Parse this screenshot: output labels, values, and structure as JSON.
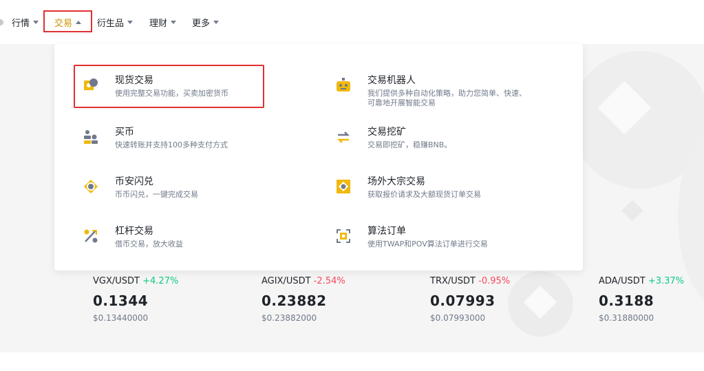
{
  "nav": {
    "items": [
      {
        "label": "行情"
      },
      {
        "label": "交易"
      },
      {
        "label": "衍生品"
      },
      {
        "label": "理财"
      },
      {
        "label": "更多"
      }
    ]
  },
  "dropdown": {
    "left_items": [
      {
        "title": "现货交易",
        "desc": "使用完整交易功能，买卖加密货币",
        "icon": "spot-trade-icon"
      },
      {
        "title": "买币",
        "desc": "快速转账并支持100多种支付方式",
        "icon": "buy-crypto-icon"
      },
      {
        "title": "币安闪兑",
        "desc": "币币闪兑，一键完成交易",
        "icon": "convert-icon"
      },
      {
        "title": "杠杆交易",
        "desc": "借币交易，放大收益",
        "icon": "margin-icon"
      }
    ],
    "right_items": [
      {
        "title": "交易机器人",
        "desc": "我们提供多种自动化策略，助力您简单、快速、可靠地开展智能交易",
        "icon": "robot-icon"
      },
      {
        "title": "交易挖矿",
        "desc": "交易即挖矿，稳赚BNB。",
        "icon": "swap-arrows-icon"
      },
      {
        "title": "场外大宗交易",
        "desc": "获取报价请求及大额现货订单交易",
        "icon": "otc-icon"
      },
      {
        "title": "算法订单",
        "desc": "使用TWAP和POV算法订单进行交易",
        "icon": "algo-order-icon"
      }
    ]
  },
  "tickers": [
    {
      "pair": "VGX/USDT",
      "change": "+4.27%",
      "direction": "up",
      "price": "0.1344",
      "usd": "$0.13440000"
    },
    {
      "pair": "AGIX/USDT",
      "change": "-2.54%",
      "direction": "down",
      "price": "0.23882",
      "usd": "$0.23882000"
    },
    {
      "pair": "TRX/USDT",
      "change": "-0.95%",
      "direction": "down",
      "price": "0.07993",
      "usd": "$0.07993000"
    },
    {
      "pair": "ADA/USDT",
      "change": "+3.37%",
      "direction": "up",
      "price": "0.3188",
      "usd": "$0.31880000"
    }
  ],
  "colors": {
    "accent": "#F0B90B",
    "active_nav": "#C99400",
    "up": "#0ECB81",
    "down": "#F6465D",
    "highlight_box": "#E03030"
  }
}
